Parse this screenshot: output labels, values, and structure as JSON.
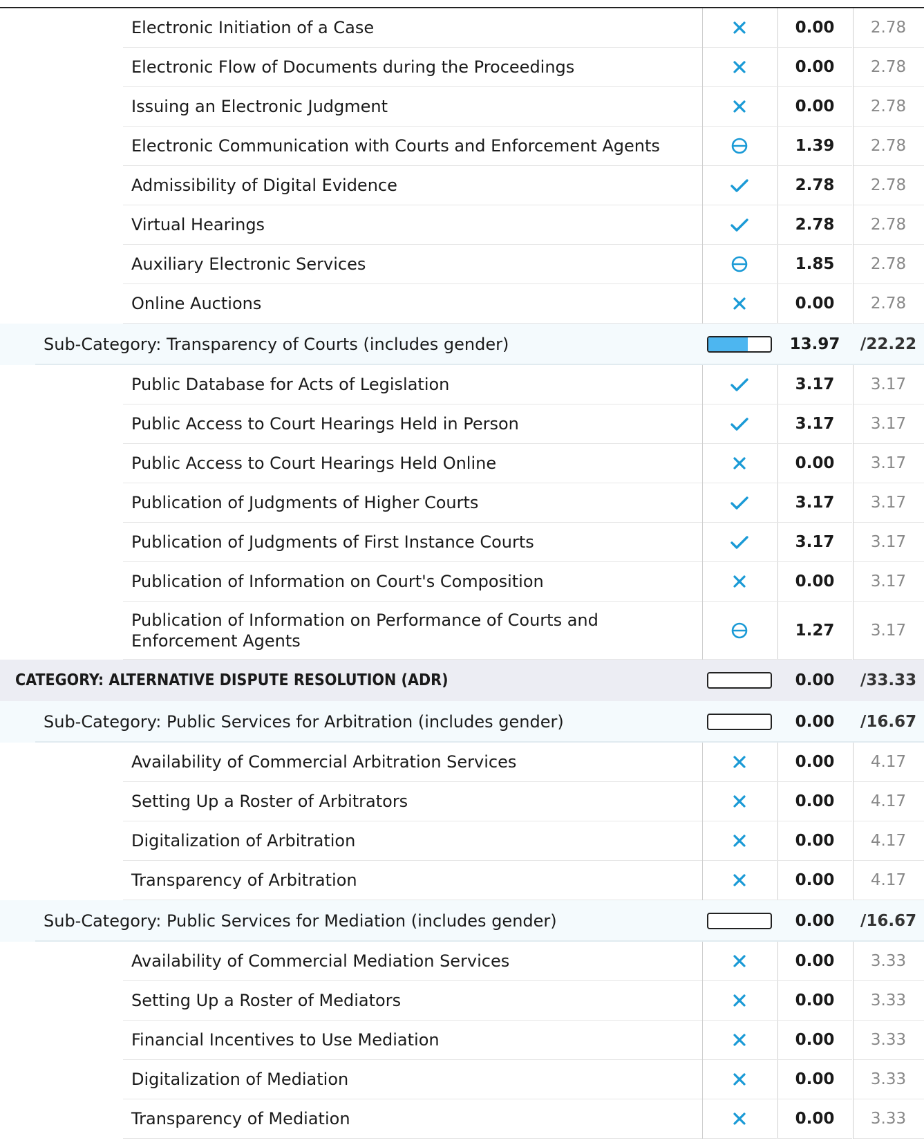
{
  "colors": {
    "accent": "#1a9ad6",
    "progress_fill": "#4db6f0"
  },
  "rows": [
    {
      "type": "indicator",
      "label": "Electronic Initiation of a Case",
      "status": "cross",
      "score": "0.00",
      "max": "2.78"
    },
    {
      "type": "indicator",
      "label": "Electronic Flow of Documents during the Proceedings",
      "status": "cross",
      "score": "0.00",
      "max": "2.78"
    },
    {
      "type": "indicator",
      "label": "Issuing an Electronic Judgment",
      "status": "cross",
      "score": "0.00",
      "max": "2.78"
    },
    {
      "type": "indicator",
      "label": "Electronic Communication with Courts and Enforcement Agents",
      "status": "partial",
      "score": "1.39",
      "max": "2.78"
    },
    {
      "type": "indicator",
      "label": "Admissibility of Digital Evidence",
      "status": "check",
      "score": "2.78",
      "max": "2.78"
    },
    {
      "type": "indicator",
      "label": "Virtual Hearings",
      "status": "check",
      "score": "2.78",
      "max": "2.78"
    },
    {
      "type": "indicator",
      "label": "Auxiliary Electronic Services",
      "status": "partial",
      "score": "1.85",
      "max": "2.78"
    },
    {
      "type": "indicator",
      "label": "Online Auctions",
      "status": "cross",
      "score": "0.00",
      "max": "2.78"
    },
    {
      "type": "subcategory",
      "label": "Sub-Category: Transparency of Courts (includes gender)",
      "score": "13.97",
      "max": "/22.22",
      "progress": 0.629
    },
    {
      "type": "indicator",
      "label": "Public Database for Acts of Legislation",
      "status": "check",
      "score": "3.17",
      "max": "3.17"
    },
    {
      "type": "indicator",
      "label": "Public Access to Court Hearings Held in Person",
      "status": "check",
      "score": "3.17",
      "max": "3.17"
    },
    {
      "type": "indicator",
      "label": "Public Access to Court Hearings Held Online",
      "status": "cross",
      "score": "0.00",
      "max": "3.17"
    },
    {
      "type": "indicator",
      "label": "Publication of Judgments of Higher Courts",
      "status": "check",
      "score": "3.17",
      "max": "3.17"
    },
    {
      "type": "indicator",
      "label": "Publication of Judgments of First Instance Courts",
      "status": "check",
      "score": "3.17",
      "max": "3.17"
    },
    {
      "type": "indicator",
      "label": "Publication of Information on Court's Composition",
      "status": "cross",
      "score": "0.00",
      "max": "3.17"
    },
    {
      "type": "indicator",
      "label": "Publication of Information on Performance of Courts and Enforcement Agents",
      "status": "partial",
      "score": "1.27",
      "max": "3.17"
    },
    {
      "type": "category",
      "label": "CATEGORY: ALTERNATIVE DISPUTE RESOLUTION (ADR)",
      "score": "0.00",
      "max": "/33.33",
      "progress": 0
    },
    {
      "type": "subcategory",
      "label": "Sub-Category: Public Services for Arbitration (includes gender)",
      "score": "0.00",
      "max": "/16.67",
      "progress": 0
    },
    {
      "type": "indicator",
      "label": "Availability of Commercial Arbitration Services",
      "status": "cross",
      "score": "0.00",
      "max": "4.17"
    },
    {
      "type": "indicator",
      "label": "Setting Up a Roster of Arbitrators",
      "status": "cross",
      "score": "0.00",
      "max": "4.17"
    },
    {
      "type": "indicator",
      "label": "Digitalization of Arbitration",
      "status": "cross",
      "score": "0.00",
      "max": "4.17"
    },
    {
      "type": "indicator",
      "label": "Transparency of Arbitration",
      "status": "cross",
      "score": "0.00",
      "max": "4.17"
    },
    {
      "type": "subcategory",
      "label": "Sub-Category: Public Services for Mediation (includes gender)",
      "score": "0.00",
      "max": "/16.67",
      "progress": 0
    },
    {
      "type": "indicator",
      "label": "Availability of Commercial Mediation Services",
      "status": "cross",
      "score": "0.00",
      "max": "3.33"
    },
    {
      "type": "indicator",
      "label": "Setting Up a Roster of Mediators",
      "status": "cross",
      "score": "0.00",
      "max": "3.33"
    },
    {
      "type": "indicator",
      "label": "Financial Incentives to Use Mediation",
      "status": "cross",
      "score": "0.00",
      "max": "3.33"
    },
    {
      "type": "indicator",
      "label": "Digitalization of Mediation",
      "status": "cross",
      "score": "0.00",
      "max": "3.33"
    },
    {
      "type": "indicator",
      "label": "Transparency of Mediation",
      "status": "cross",
      "score": "0.00",
      "max": "3.33"
    }
  ]
}
